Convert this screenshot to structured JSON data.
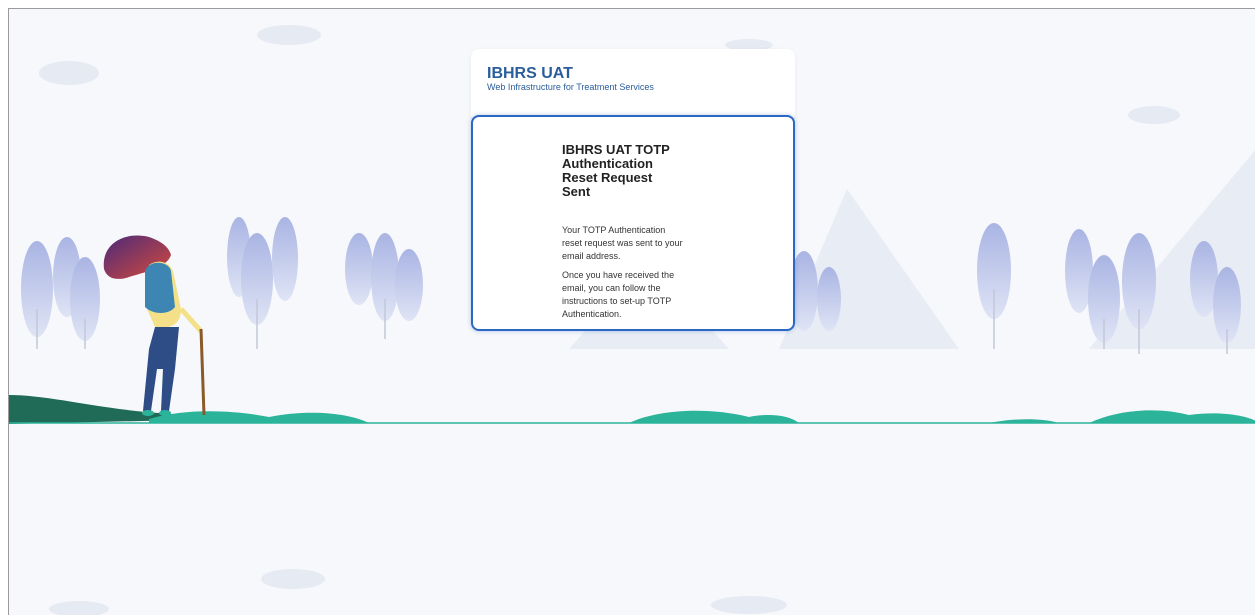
{
  "header": {
    "app_title": "IBHRS UAT",
    "app_subtitle": "Web Infrastructure for Treatment Services"
  },
  "card": {
    "heading": "IBHRS UAT TOTP Authentication Reset Request Sent",
    "message_1": "Your TOTP Authentication reset request was sent to your email address.",
    "message_2": "Once you have received the email, you can follow the instructions to set-up TOTP Authentication."
  },
  "colors": {
    "brand_blue": "#2a5d9b",
    "card_border": "#2a68c4",
    "grass": "#2bb49a",
    "hill_dark": "#1f6b57",
    "tree": "#b6c0e6"
  },
  "illustration": {
    "icons": [
      "hiker-figure",
      "tree-icon",
      "mountain-icon",
      "cloud-icon",
      "grass-icon"
    ]
  }
}
